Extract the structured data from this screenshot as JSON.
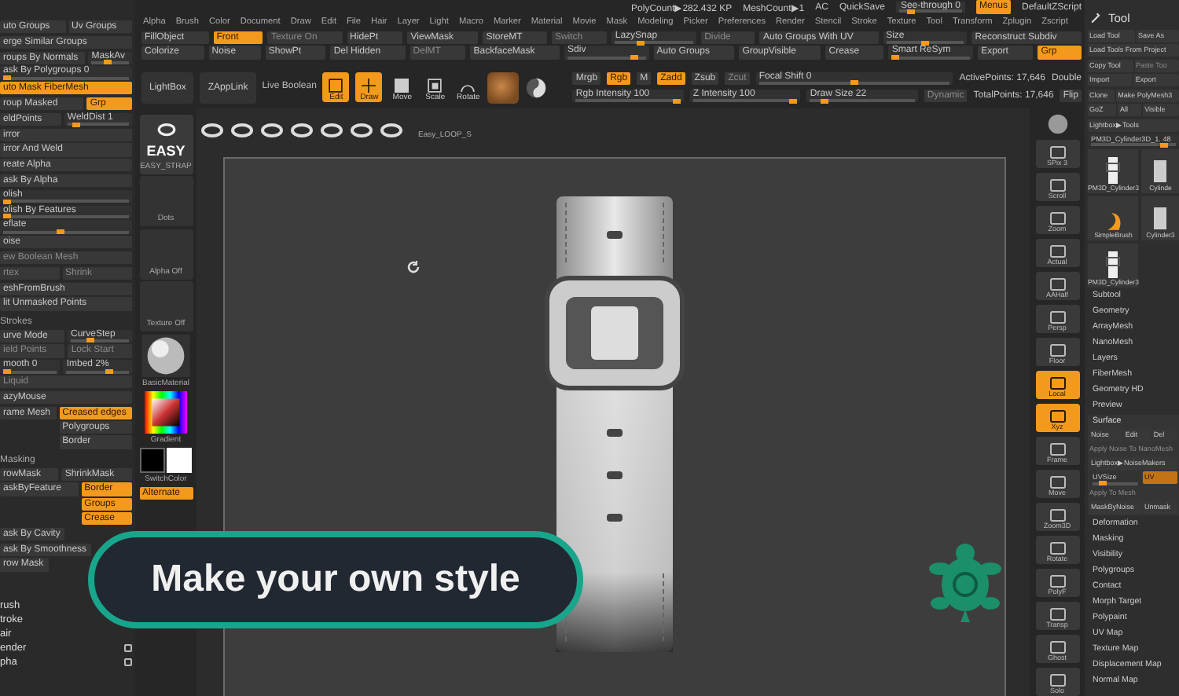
{
  "status_bar": {
    "poly_count": "PolyCount▶282.432 KP",
    "mesh_count": "MeshCount▶1",
    "ac": "AC",
    "quicksave": "QuickSave",
    "see_through": {
      "label": "See-through  0",
      "level": 0.15
    },
    "menus": {
      "label": "Menus",
      "on": true
    },
    "script": "DefaultZScript"
  },
  "menu_bar": [
    "Alpha",
    "Brush",
    "Color",
    "Document",
    "Draw",
    "Edit",
    "File",
    "Hair",
    "Layer",
    "Light",
    "Macro",
    "Marker",
    "Material",
    "Movie",
    "Mask",
    "Modeling",
    "Picker",
    "Preferences",
    "Render",
    "Stencil",
    "Stroke",
    "Texture",
    "Tool",
    "Transform",
    "Zplugin",
    "Zscript"
  ],
  "toolbar_rows": [
    [
      {
        "kind": "button",
        "label": "FillObject",
        "on": false,
        "disabled": false
      },
      {
        "kind": "button",
        "label": "Front",
        "on": true,
        "disabled": false
      },
      {
        "kind": "button",
        "label": "Texture On",
        "on": false,
        "disabled": true
      },
      {
        "kind": "button",
        "label": "HidePt",
        "on": false,
        "disabled": false
      },
      {
        "kind": "button",
        "label": "ViewMask",
        "on": false,
        "disabled": false
      },
      {
        "kind": "button",
        "label": "StoreMT",
        "on": false,
        "disabled": false
      },
      {
        "kind": "button",
        "label": "Switch",
        "on": false,
        "disabled": true
      },
      {
        "kind": "slider",
        "label": "LazySnap",
        "level": 0.3
      },
      {
        "kind": "button",
        "label": "Divide",
        "on": false,
        "disabled": true
      },
      {
        "kind": "button",
        "label": "Auto Groups With UV",
        "on": false,
        "disabled": false
      },
      {
        "kind": "slider",
        "label": "Size",
        "level": 0.5
      },
      {
        "kind": "button",
        "label": "Reconstruct Subdiv",
        "on": false,
        "disabled": false
      }
    ],
    [
      {
        "kind": "button",
        "label": "Colorize",
        "on": false,
        "disabled": false
      },
      {
        "kind": "button",
        "label": "Noise",
        "on": false,
        "disabled": false
      },
      {
        "kind": "button",
        "label": "ShowPt",
        "on": false,
        "disabled": false
      },
      {
        "kind": "button",
        "label": "Del Hidden",
        "on": false,
        "disabled": false
      },
      {
        "kind": "button",
        "label": "DelMT",
        "on": false,
        "disabled": true
      },
      {
        "kind": "button",
        "label": "BackfaceMask",
        "on": false,
        "disabled": false
      },
      {
        "kind": "slider",
        "label": "Sdiv",
        "level": 0.9
      },
      {
        "kind": "button",
        "label": "Auto Groups",
        "on": false,
        "disabled": false
      },
      {
        "kind": "button",
        "label": "GroupVisible",
        "on": false,
        "disabled": false
      },
      {
        "kind": "button",
        "label": "Crease",
        "on": false,
        "disabled": false
      },
      {
        "kind": "slider",
        "label": "Smart ReSym",
        "level": 0
      },
      {
        "kind": "button",
        "label": "Export",
        "on": false,
        "disabled": false
      },
      {
        "kind": "button",
        "label": "Grp",
        "on": true,
        "disabled": false
      }
    ]
  ],
  "draw_bar": {
    "lightbox": "LightBox",
    "zapplink": "ZAppLink",
    "live_boolean": "Live Boolean",
    "tools": [
      {
        "label": "Edit",
        "on": true
      },
      {
        "label": "Draw",
        "on": true
      },
      {
        "label": "Move",
        "on": false
      },
      {
        "label": "Scale",
        "on": false
      },
      {
        "label": "Rotate",
        "on": false
      }
    ],
    "upper_controls": [
      {
        "kind": "button",
        "label": "Mrgb",
        "on": false,
        "disabled": false
      },
      {
        "kind": "button",
        "label": "Rgb",
        "on": true,
        "disabled": false
      },
      {
        "kind": "button",
        "label": "M",
        "on": false,
        "disabled": false
      },
      {
        "kind": "button",
        "label": "Zadd",
        "on": true,
        "disabled": false
      },
      {
        "kind": "button",
        "label": "Zsub",
        "on": false,
        "disabled": false
      },
      {
        "kind": "button",
        "label": "Zcut",
        "on": false,
        "disabled": true
      },
      {
        "kind": "slider",
        "label": "Focal Shift 0",
        "level": 0.5
      },
      {
        "kind": "text",
        "label": "ActivePoints: 17,646"
      },
      {
        "kind": "text",
        "label": "Double"
      }
    ],
    "lower_controls": [
      {
        "kind": "slider",
        "label": "Rgb Intensity 100",
        "level": 1
      },
      {
        "kind": "slider",
        "label": "Z Intensity 100",
        "level": 1
      },
      {
        "kind": "slider",
        "label": "Draw Size 22",
        "level": 0.1
      },
      {
        "kind": "button",
        "label": "Dynamic",
        "on": false,
        "disabled": true
      },
      {
        "kind": "text",
        "label": "TotalPoints: 17,646"
      },
      {
        "kind": "button",
        "label": "Flip",
        "on": false,
        "disabled": false
      }
    ]
  },
  "brush_strip": {
    "label": "Easy_LOOP_S"
  },
  "left_shelf": {
    "brush": {
      "title": "EASY",
      "name": "EASY_STRAP"
    },
    "stroke": "Dots",
    "alpha": "Alpha Off",
    "texture": "Texture Off",
    "material": "BasicMaterial",
    "gradient": "Gradient",
    "switch_color": "SwitchColor",
    "alternate": {
      "label": "Alternate",
      "on": true
    }
  },
  "left_panel": [
    {
      "cells": [
        {
          "kind": "button",
          "label": "uto Groups",
          "on": false,
          "disabled": false
        },
        {
          "kind": "button",
          "label": "Uv Groups",
          "on": false,
          "disabled": false
        }
      ]
    },
    {
      "cells": [
        {
          "kind": "button",
          "label": "erge Similar Groups",
          "on": false,
          "disabled": false
        }
      ]
    },
    {
      "cells": [
        {
          "kind": "button",
          "label": "roups By Normals",
          "on": false,
          "disabled": false
        },
        {
          "kind": "slider",
          "label": "MaskAv",
          "level": 0.4
        }
      ]
    },
    {
      "cells": [
        {
          "kind": "slider",
          "label": "ask By Polygroups 0",
          "level": 0
        }
      ]
    },
    {
      "cells": [
        {
          "kind": "button",
          "label": "uto Mask FiberMesh",
          "on": true,
          "disabled": false
        }
      ]
    },
    {
      "cells": [
        {
          "kind": "button",
          "label": "roup Masked",
          "on": false,
          "disabled": false
        },
        {
          "kind": "button",
          "label": "Grp",
          "on": true,
          "disabled": false
        }
      ]
    },
    {
      "cells": [
        {
          "kind": "button",
          "label": "eldPoints",
          "on": false,
          "disabled": false
        },
        {
          "kind": "slider",
          "label": "WeldDist 1",
          "level": 0.1
        }
      ]
    },
    {
      "cells": [
        {
          "kind": "button",
          "label": "irror",
          "on": false,
          "disabled": false
        }
      ]
    },
    {
      "cells": [
        {
          "kind": "button",
          "label": "irror And Weld",
          "on": false,
          "disabled": false
        }
      ]
    },
    {
      "cells": [
        {
          "kind": "button",
          "label": "reate Alpha",
          "on": false,
          "disabled": false
        }
      ]
    },
    {
      "cells": [
        {
          "kind": "button",
          "label": "ask By Alpha",
          "on": false,
          "disabled": false
        }
      ]
    },
    {
      "cells": [
        {
          "kind": "slider",
          "label": "olish",
          "level": 0
        }
      ]
    },
    {
      "cells": [
        {
          "kind": "slider",
          "label": "olish By Features",
          "level": 0
        }
      ]
    },
    {
      "cells": [
        {
          "kind": "slider",
          "label": "eflate",
          "level": 0.45
        }
      ]
    },
    {
      "cells": [
        {
          "kind": "button",
          "label": "oise",
          "on": false,
          "disabled": false
        }
      ]
    },
    {
      "cells": [
        {
          "kind": "button",
          "label": "ew Boolean Mesh",
          "on": false,
          "disabled": true
        }
      ]
    },
    {
      "cells": [
        {
          "kind": "button",
          "label": "rtex",
          "on": false,
          "disabled": true
        },
        {
          "kind": "button",
          "label": "Shrink",
          "on": false,
          "disabled": true
        }
      ]
    },
    {
      "cells": [
        {
          "kind": "button",
          "label": "eshFromBrush",
          "on": false,
          "disabled": false
        }
      ]
    },
    {
      "cells": [
        {
          "kind": "button",
          "label": "lit Unmasked Points",
          "on": false,
          "disabled": false
        }
      ]
    },
    {
      "cells": [
        {
          "kind": "heading",
          "label": "Strokes"
        }
      ]
    },
    {
      "cells": [
        {
          "kind": "button",
          "label": "urve Mode",
          "on": false,
          "disabled": false
        },
        {
          "kind": "slider",
          "label": "CurveStep",
          "level": 0.3
        }
      ]
    },
    {
      "cells": [
        {
          "kind": "button",
          "label": "ield Points",
          "on": false,
          "disabled": true
        },
        {
          "kind": "button",
          "label": "Lock Start",
          "on": false,
          "disabled": true
        }
      ]
    },
    {
      "cells": [
        {
          "kind": "slider",
          "label": "mooth 0",
          "level": 0
        },
        {
          "kind": "slider",
          "label": "Imbed 2%",
          "level": 0.7
        }
      ]
    },
    {
      "cells": [
        {
          "kind": "button",
          "label": "Liquid",
          "on": false,
          "disabled": true
        }
      ]
    },
    {
      "cells": [
        {
          "kind": "button",
          "label": "azyMouse",
          "on": false,
          "disabled": false
        }
      ]
    },
    {
      "cells": [
        {
          "kind": "button",
          "label": "rame Mesh",
          "on": false,
          "disabled": false
        },
        {
          "kind": "stack",
          "items": [
            {
              "label": "Creased edges",
              "on": true
            },
            {
              "label": "Polygroups",
              "on": false
            },
            {
              "label": "Border",
              "on": false
            }
          ]
        }
      ]
    },
    {
      "cells": [
        {
          "kind": "heading",
          "label": "Masking"
        }
      ]
    },
    {
      "cells": [
        {
          "kind": "button",
          "label": "rowMask",
          "on": false,
          "disabled": false
        },
        {
          "kind": "button",
          "label": "ShrinkMask",
          "on": false,
          "disabled": false
        }
      ]
    },
    {
      "cells": [
        {
          "kind": "button",
          "label": "askByFeature",
          "on": false,
          "disabled": false
        },
        {
          "kind": "stack",
          "items": [
            {
              "label": "Border",
              "on": true
            },
            {
              "label": "Groups",
              "on": true
            },
            {
              "label": "Crease",
              "on": true
            }
          ]
        }
      ]
    },
    {
      "cells": [
        {
          "kind": "button",
          "label": "ask By Cavity",
          "on": false,
          "disabled": false
        }
      ]
    },
    {
      "cells": [
        {
          "kind": "button",
          "label": "ask By Smoothness",
          "on": false,
          "disabled": false
        }
      ]
    },
    {
      "cells": [
        {
          "kind": "button",
          "label": "row Mask",
          "on": false,
          "disabled": false
        }
      ]
    }
  ],
  "palettes": [
    {
      "label": "rush",
      "popout": false
    },
    {
      "label": "troke",
      "popout": false
    },
    {
      "label": "air",
      "popout": false
    },
    {
      "label": "ender",
      "popout": true
    },
    {
      "label": "pha",
      "popout": true
    }
  ],
  "right_shelf": [
    {
      "label": "SPix 3",
      "on": false
    },
    {
      "label": "Scroll",
      "on": false
    },
    {
      "label": "Zoom",
      "on": false
    },
    {
      "label": "Actual",
      "on": false
    },
    {
      "label": "AAHalf",
      "on": false
    },
    {
      "label": "Persp",
      "on": false
    },
    {
      "label": "Floor",
      "on": false
    },
    {
      "label": "Local",
      "on": true
    },
    {
      "label": "Xyz",
      "on": true
    },
    {
      "label": "Frame",
      "on": false
    },
    {
      "label": "Move",
      "on": false
    },
    {
      "label": "Zoom3D",
      "on": false
    },
    {
      "label": "Rotate",
      "on": false
    },
    {
      "label": "PolyF",
      "on": false
    },
    {
      "label": "Transp",
      "on": false
    },
    {
      "label": "Ghost",
      "on": false
    },
    {
      "label": "Solo",
      "on": false
    }
  ],
  "tool_panel": {
    "title": "Tool",
    "button_rows": [
      [
        {
          "label": "Load Tool",
          "disabled": false
        },
        {
          "label": "Save As",
          "disabled": false
        }
      ],
      [
        {
          "label": "Load Tools From Project",
          "disabled": false
        }
      ],
      [
        {
          "label": "Copy Tool",
          "disabled": false
        },
        {
          "label": "Paste Too",
          "disabled": true
        }
      ],
      [
        {
          "label": "Import",
          "disabled": false
        },
        {
          "label": "Export",
          "disabled": false
        }
      ],
      [
        {
          "label": "Clone",
          "disabled": false
        },
        {
          "label": "Make PolyMesh3",
          "disabled": false
        }
      ],
      [
        {
          "label": "GoZ",
          "disabled": false
        },
        {
          "label": "All",
          "disabled": false
        },
        {
          "label": "Visible",
          "disabled": false
        }
      ],
      [
        {
          "label": "Lightbox▶Tools",
          "disabled": false
        }
      ]
    ],
    "current_tool": {
      "label": "PM3D_Cylinder3D_1. 48",
      "level": 0.9
    },
    "thumbnails": [
      {
        "label": "PM3D_Cylinder3",
        "kind": "strap"
      },
      {
        "label": "Cylinde",
        "kind": "cylinder"
      },
      {
        "label": "SimpleBrush",
        "kind": "brush"
      },
      {
        "label": "Cylinder3",
        "kind": "cylinder"
      },
      {
        "label": "PM3D_Cylinder3",
        "kind": "strap"
      }
    ],
    "subpalettes": [
      "Subtool",
      "Geometry",
      "ArrayMesh",
      "NanoMesh",
      "Layers",
      "FiberMesh",
      "Geometry HD",
      "Preview"
    ],
    "surface": {
      "title": "Surface",
      "buttons": [
        {
          "label": "Noise",
          "disabled": false
        },
        {
          "label": "Edit",
          "disabled": false
        },
        {
          "label": "Del",
          "disabled": false
        }
      ],
      "apply_nanomesh": "Apply Noise To NanoMesh",
      "noisemakers": "Lightbox▶NoiseMakers",
      "uv_slider": {
        "label": "UVSize",
        "level": 0.15
      },
      "uv_button": "UV",
      "apply_mesh": "Apply To Mesh",
      "mask_buttons": [
        "MaskByNoise",
        "Unmask"
      ]
    },
    "more_subpalettes": [
      "Deformation",
      "Masking",
      "Visibility",
      "Polygroups",
      "Contact",
      "Morph Target",
      "Polypaint",
      "UV Map",
      "Texture Map",
      "Displacement Map",
      "Normal Map"
    ]
  },
  "caption": "Make your own style"
}
